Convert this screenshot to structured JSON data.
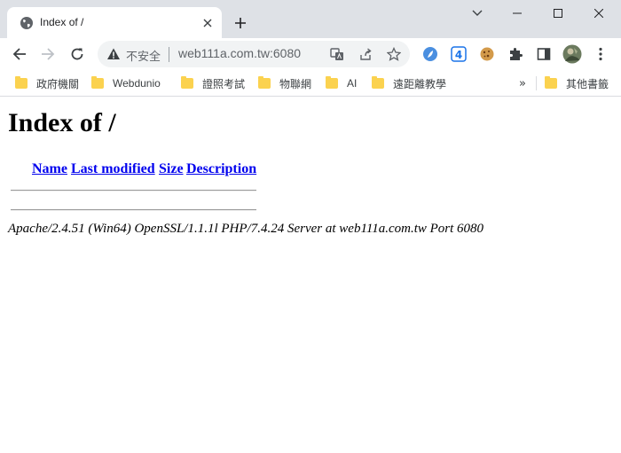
{
  "tab": {
    "title": "Index of /",
    "favicon": "globe-icon"
  },
  "toolbar": {
    "security_label": "不安全",
    "url": "web111a.com.tw:6080"
  },
  "bookmarks": {
    "items": [
      {
        "label": "政府機關"
      },
      {
        "label": "Webdunio"
      },
      {
        "label": "證照考試"
      },
      {
        "label": "物聯網"
      },
      {
        "label": "AI"
      },
      {
        "label": "遠距離教學"
      }
    ],
    "more": "»",
    "other": "其他書籤"
  },
  "page": {
    "heading": "Index of /",
    "columns": {
      "name": "Name",
      "last_modified": "Last modified",
      "size": "Size",
      "description": "Description"
    },
    "rows": [],
    "address": "Apache/2.4.51 (Win64) OpenSSL/1.1.1l PHP/7.4.24 Server at web111a.com.tw Port 6080"
  },
  "colors": {
    "tabstrip": "#dee1e6",
    "omnibox": "#f1f3f4",
    "link": "#0000ee",
    "folder": "#fbd24f"
  }
}
